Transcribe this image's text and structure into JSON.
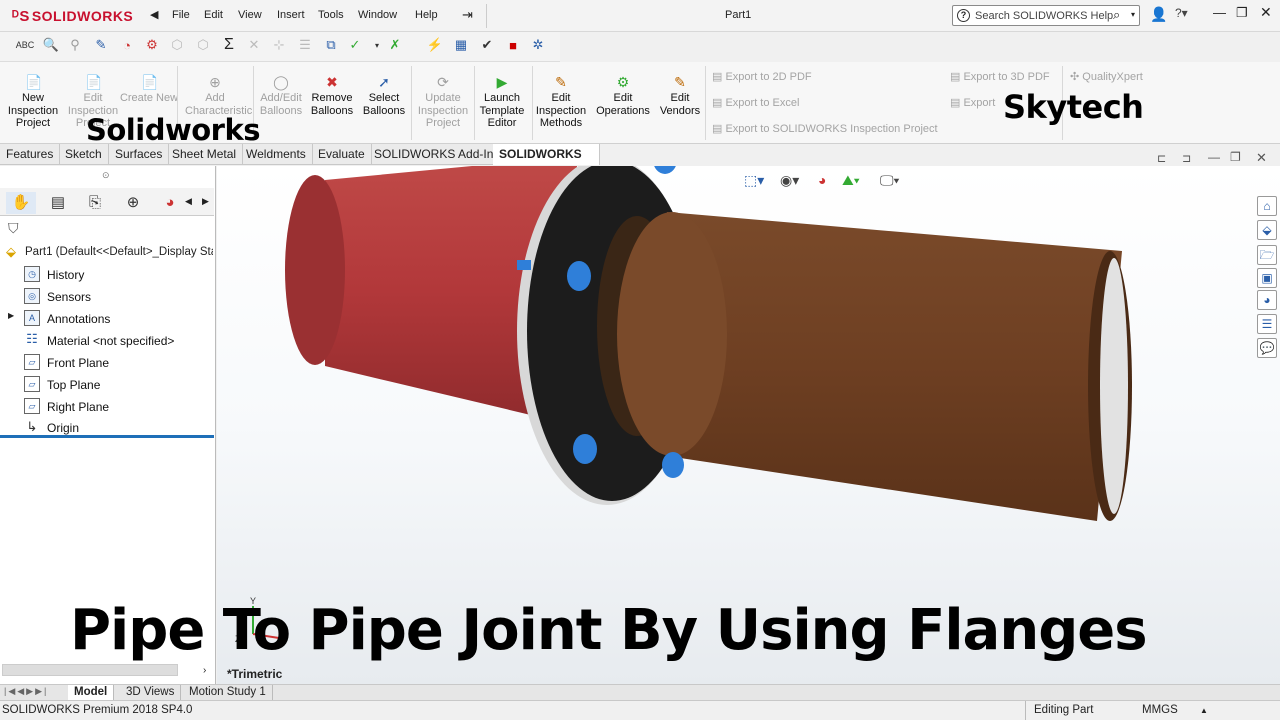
{
  "app": {
    "logo_text": "SOLIDWORKS",
    "doc_title": "Part1"
  },
  "menu": [
    "File",
    "Edit",
    "View",
    "Insert",
    "Tools",
    "Window",
    "Help"
  ],
  "search": {
    "placeholder": "Search SOLIDWORKS Help"
  },
  "commands": [
    {
      "label": "New Inspection Project",
      "enabled": true
    },
    {
      "label": "Edit Inspection Project",
      "enabled": false
    },
    {
      "label": "Create New",
      "enabled": false
    },
    {
      "label": "Add Characteristic",
      "enabled": false
    },
    {
      "label": "Add/Edit Balloons",
      "enabled": false
    },
    {
      "label": "Remove Balloons",
      "enabled": true
    },
    {
      "label": "Select Balloons",
      "enabled": true
    },
    {
      "label": "Update Inspection Project",
      "enabled": false
    },
    {
      "label": "Launch Template Editor",
      "enabled": true
    },
    {
      "label": "Edit Inspection Methods",
      "enabled": true
    },
    {
      "label": "Edit Operations",
      "enabled": true
    },
    {
      "label": "Edit Vendors",
      "enabled": true
    }
  ],
  "exports": {
    "pdf2d": "Export to 2D PDF",
    "excel": "Export to Excel",
    "inspection": "Export to SOLIDWORKS Inspection Project",
    "pdf3d": "Export to 3D PDF",
    "export": "Export",
    "qualityxpert": "QualityXpert"
  },
  "tabs": [
    "Features",
    "Sketch",
    "Surfaces",
    "Sheet Metal",
    "Weldments",
    "Evaluate",
    "SOLIDWORKS Add-Ins",
    "SOLIDWORKS Ins"
  ],
  "tree": {
    "root": "Part1  (Default<<Default>_Display Sta",
    "items": [
      "History",
      "Sensors",
      "Annotations",
      "Material <not specified>",
      "Front Plane",
      "Top Plane",
      "Right Plane",
      "Origin"
    ]
  },
  "viewport": {
    "view_label": "*Trimetric"
  },
  "bottom_tabs": [
    "Model",
    "3D Views",
    "Motion Study 1"
  ],
  "status": {
    "product": "SOLIDWORKS Premium 2018 SP4.0",
    "mode": "Editing Part",
    "units": "MMGS"
  },
  "overlay": {
    "left_brand": "Solidworks",
    "right_brand": "Skytech",
    "title": "Pipe To Pipe Joint By Using Flanges"
  },
  "colors": {
    "red_pipe": "#b2383a",
    "brown_pipe": "#6e3f22",
    "flange": "#1c1c1c",
    "bolt": "#2f7fd9",
    "accent": "#c8102e"
  }
}
